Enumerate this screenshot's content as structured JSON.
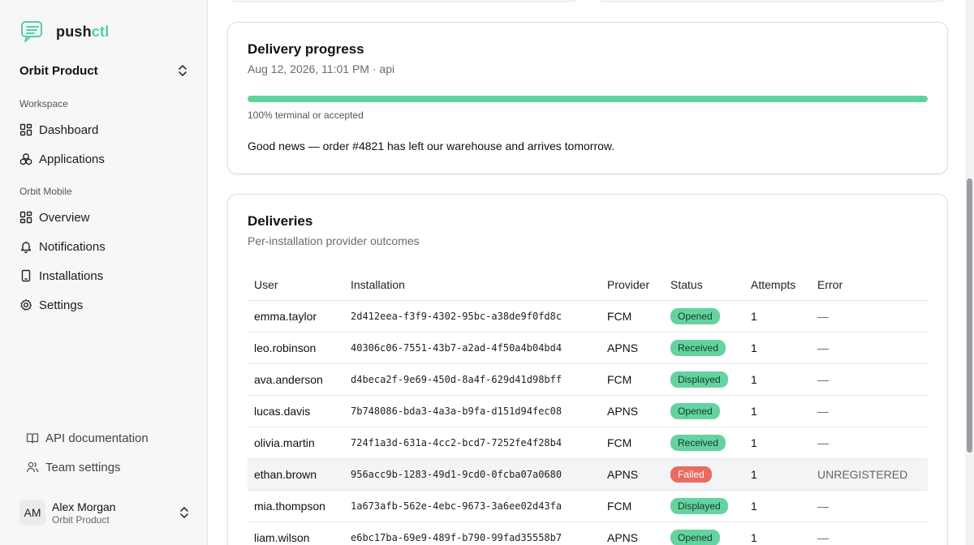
{
  "brand": {
    "name_prefix": "push",
    "name_suffix": "ctl",
    "accent": "#4fd39a"
  },
  "org_switcher": {
    "name": "Orbit Product"
  },
  "sidebar": {
    "workspace_label": "Workspace",
    "workspace_items": [
      {
        "label": "Dashboard",
        "icon": "dashboard-icon"
      },
      {
        "label": "Applications",
        "icon": "applications-icon"
      }
    ],
    "app_label": "Orbit Mobile",
    "app_items": [
      {
        "label": "Overview",
        "icon": "overview-icon"
      },
      {
        "label": "Notifications",
        "icon": "bell-icon"
      },
      {
        "label": "Installations",
        "icon": "phone-icon"
      },
      {
        "label": "Settings",
        "icon": "gear-icon"
      }
    ],
    "footer_items": [
      {
        "label": "API documentation",
        "icon": "book-icon"
      },
      {
        "label": "Team settings",
        "icon": "team-icon"
      }
    ],
    "user": {
      "initials": "AM",
      "name": "Alex Morgan",
      "org": "Orbit Product"
    }
  },
  "progress_card": {
    "title": "Delivery progress",
    "subtitle": "Aug 12, 2026, 11:01 PM · api",
    "progress_percent": 100,
    "caption": "100% terminal or accepted",
    "message": "Good news — order #4821 has left our warehouse and arrives tomorrow.",
    "bar_color": "#5fd39c"
  },
  "deliveries_card": {
    "title": "Deliveries",
    "subtitle": "Per-installation provider outcomes",
    "columns": [
      "User",
      "Installation",
      "Provider",
      "Status",
      "Attempts",
      "Error"
    ],
    "rows": [
      {
        "user": "emma.taylor",
        "installation": "2d412eea-f3f9-4302-95bc-a38de9f0fd8c",
        "provider": "FCM",
        "status": "Opened",
        "attempts": "1",
        "error": "—"
      },
      {
        "user": "leo.robinson",
        "installation": "40306c06-7551-43b7-a2ad-4f50a4b04bd4",
        "provider": "APNS",
        "status": "Received",
        "attempts": "1",
        "error": "—"
      },
      {
        "user": "ava.anderson",
        "installation": "d4beca2f-9e69-450d-8a4f-629d41d98bff",
        "provider": "FCM",
        "status": "Displayed",
        "attempts": "1",
        "error": "—"
      },
      {
        "user": "lucas.davis",
        "installation": "7b748086-bda3-4a3a-b9fa-d151d94fec08",
        "provider": "APNS",
        "status": "Opened",
        "attempts": "1",
        "error": "—"
      },
      {
        "user": "olivia.martin",
        "installation": "724f1a3d-631a-4cc2-bcd7-7252fe4f28b4",
        "provider": "FCM",
        "status": "Received",
        "attempts": "1",
        "error": "—"
      },
      {
        "user": "ethan.brown",
        "installation": "956acc9b-1283-49d1-9cd0-0fcba07a0680",
        "provider": "APNS",
        "status": "Failed",
        "attempts": "1",
        "error": "UNREGISTERED"
      },
      {
        "user": "mia.thompson",
        "installation": "1a673afb-562e-4ebc-9673-3a6ee02d43fa",
        "provider": "FCM",
        "status": "Displayed",
        "attempts": "1",
        "error": "—"
      },
      {
        "user": "liam.wilson",
        "installation": "e6bc17ba-69e9-489f-b790-99fad35558b7",
        "provider": "APNS",
        "status": "Opened",
        "attempts": "1",
        "error": "—"
      }
    ],
    "status_colors": {
      "success": "#64d39f",
      "failed": "#ea6b60"
    }
  }
}
